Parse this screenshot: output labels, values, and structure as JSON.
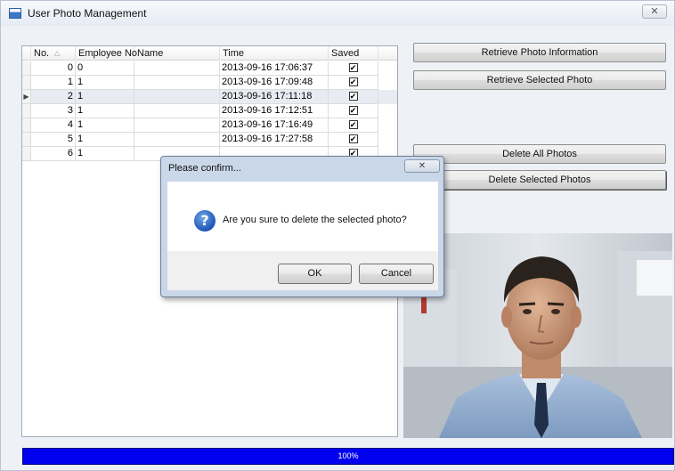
{
  "window": {
    "title": "User Photo Management",
    "close_glyph": "✕"
  },
  "grid": {
    "columns": [
      "No.",
      "Employee No",
      "Name",
      "Time",
      "Saved"
    ],
    "sort_icon": "△",
    "selected_row_marker": "▶",
    "rows": [
      {
        "no": "0",
        "employee_no": "0",
        "name": "",
        "time": "2013-09-16 17:06:37",
        "saved": true
      },
      {
        "no": "1",
        "employee_no": "1",
        "name": "",
        "time": "2013-09-16 17:09:48",
        "saved": true
      },
      {
        "no": "2",
        "employee_no": "1",
        "name": "",
        "time": "2013-09-16 17:11:18",
        "saved": true
      },
      {
        "no": "3",
        "employee_no": "1",
        "name": "",
        "time": "2013-09-16 17:12:51",
        "saved": true
      },
      {
        "no": "4",
        "employee_no": "1",
        "name": "",
        "time": "2013-09-16 17:16:49",
        "saved": true
      },
      {
        "no": "5",
        "employee_no": "1",
        "name": "",
        "time": "2013-09-16 17:27:58",
        "saved": true
      },
      {
        "no": "6",
        "employee_no": "1",
        "name": "",
        "time": "",
        "saved": true
      }
    ],
    "selected_index": 2
  },
  "buttons": {
    "retrieve_info": "Retrieve Photo Information",
    "retrieve_selected": "Retrieve Selected Photo",
    "delete_all": "Delete All Photos",
    "delete_selected": "Delete Selected Photos"
  },
  "progress": {
    "value": 1.0,
    "text": "100%",
    "color": "#0000ee"
  },
  "dialog": {
    "title": "Please confirm...",
    "close_glyph": "✕",
    "icon": "question-icon",
    "icon_glyph": "?",
    "message": "Are you sure to delete the selected photo?",
    "ok_label": "OK",
    "cancel_label": "Cancel"
  },
  "photo": {
    "subject": "employee-portrait"
  },
  "colors": {
    "accent_blue": "#0000ee",
    "selected_row": "#e8ecf2",
    "dialog_frame": "#c9d7e9"
  }
}
